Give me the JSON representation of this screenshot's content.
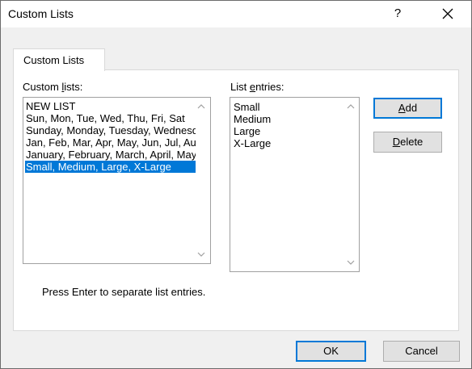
{
  "window": {
    "title": "Custom Lists",
    "help_glyph": "?"
  },
  "tab": {
    "label": "Custom Lists"
  },
  "custom_lists": {
    "label_pre": "Custom ",
    "label_u": "l",
    "label_post": "ists:",
    "items": [
      "NEW LIST",
      "Sun, Mon, Tue, Wed, Thu, Fri, Sat",
      "Sunday, Monday, Tuesday, Wednesday, Thursday, Friday, Saturday",
      "Jan, Feb, Mar, Apr, May, Jun, Jul, Aug, Sep, Oct, Nov, Dec",
      "January, February, March, April, May, June, July, August, September, October, November, December",
      "Small, Medium, Large, X-Large"
    ],
    "selected_index": 5
  },
  "list_entries": {
    "label_pre": "List ",
    "label_u": "e",
    "label_post": "ntries:",
    "items": [
      "Small",
      "Medium",
      "Large",
      "X-Large"
    ]
  },
  "buttons": {
    "add_u": "A",
    "add_rest": "dd",
    "delete_u": "D",
    "delete_rest": "elete",
    "ok": "OK",
    "cancel": "Cancel"
  },
  "hint": "Press Enter to separate list entries."
}
